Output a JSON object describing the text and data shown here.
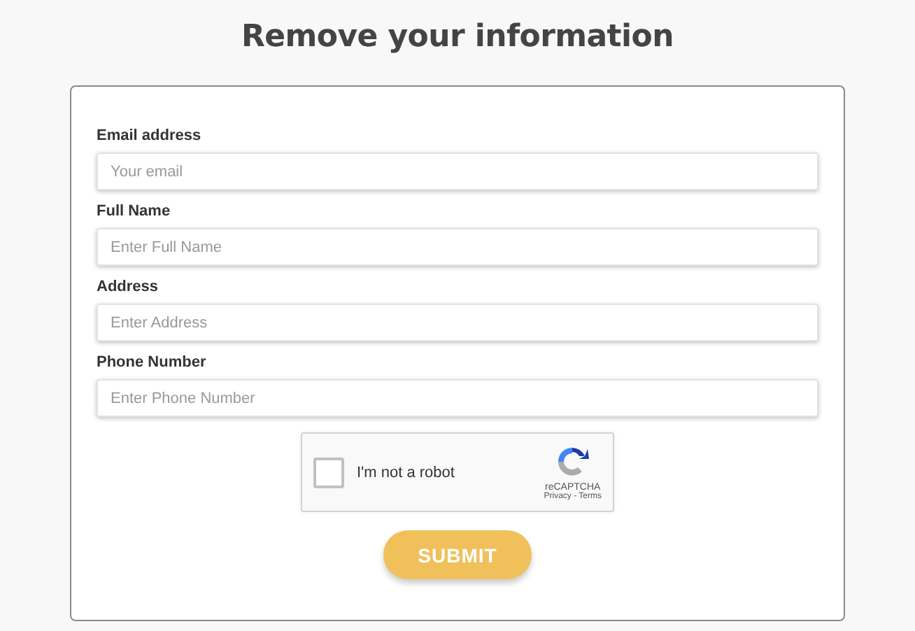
{
  "title": "Remove your information",
  "fields": [
    {
      "label": "Email address",
      "placeholder": "Your email"
    },
    {
      "label": "Full Name",
      "placeholder": "Enter Full Name"
    },
    {
      "label": "Address",
      "placeholder": "Enter Address"
    },
    {
      "label": "Phone Number",
      "placeholder": "Enter Phone Number"
    }
  ],
  "captcha": {
    "label": "I'm not a robot",
    "checked": false,
    "brand": "reCAPTCHA",
    "links": "Privacy - Terms"
  },
  "submit": "SUBMIT"
}
